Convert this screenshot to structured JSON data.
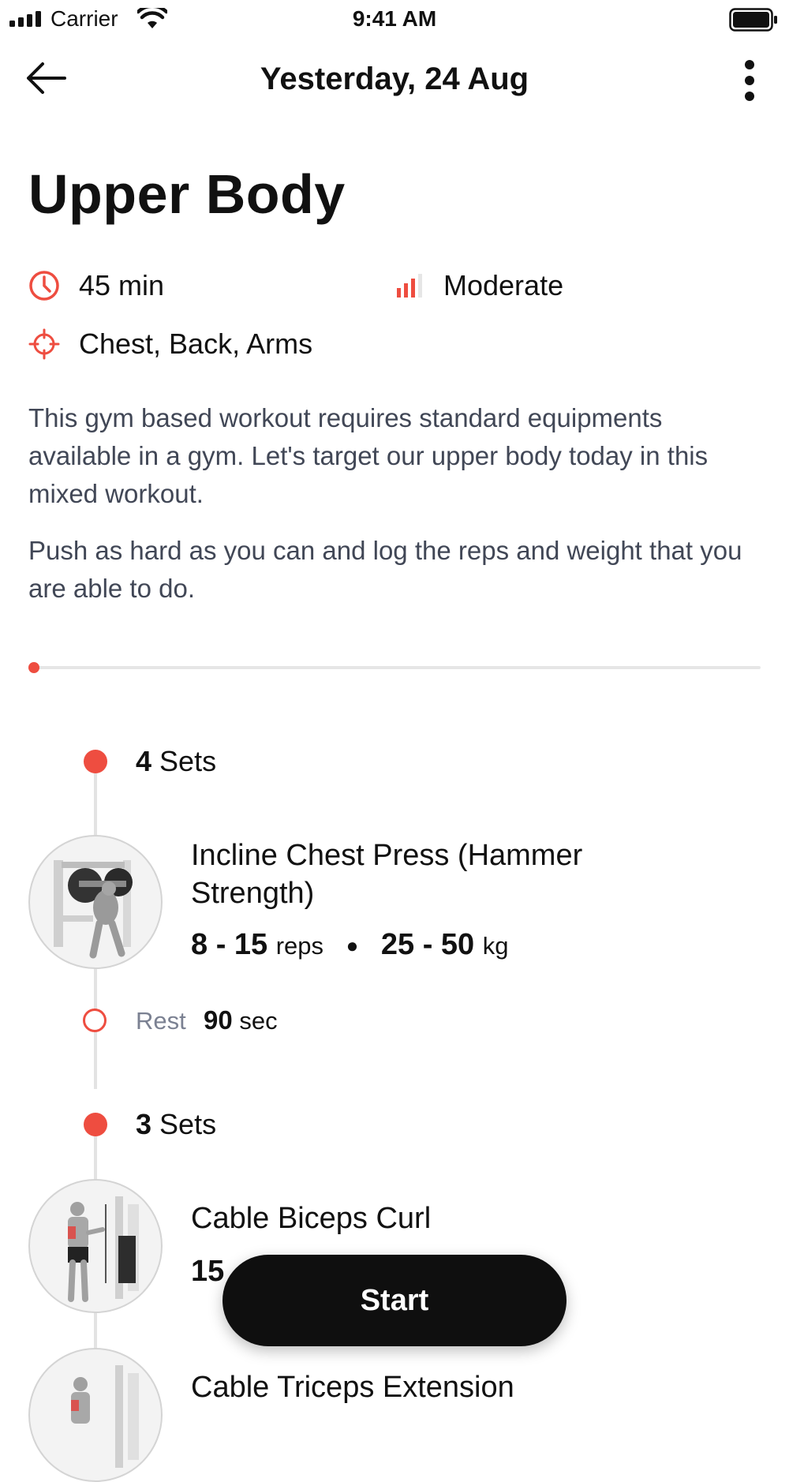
{
  "status_bar": {
    "carrier": "Carrier",
    "time": "9:41 AM"
  },
  "nav": {
    "title": "Yesterday, 24 Aug"
  },
  "workout": {
    "title": "Upper Body",
    "duration": "45 min",
    "level": "Moderate",
    "muscles": "Chest, Back, Arms",
    "description": [
      "This gym based workout requires standard equipments available in a gym. Let's target our upper body today in this mixed workout.",
      "Push as hard as you can and log the reps and weight that you are able to do."
    ]
  },
  "progress": {
    "fraction": 0.0
  },
  "exercises": [
    {
      "sets_count": "4",
      "sets_word": "Sets",
      "name": "Incline Chest Press (Hammer Strength)",
      "reps": "8 - 15",
      "reps_unit": "reps",
      "weight": "25 - 50",
      "weight_unit": "kg",
      "rest_label": "Rest",
      "rest_value": "90",
      "rest_unit": "sec"
    },
    {
      "sets_count": "3",
      "sets_word": "Sets",
      "name": "Cable Biceps Curl",
      "reps": "15"
    },
    {
      "name": "Cable Triceps Extension"
    }
  ],
  "actions": {
    "start_label": "Start"
  },
  "colors": {
    "accent": "#ee4d40",
    "button": "#0f0f0f",
    "body_text": "#414756",
    "muted": "#7b8192"
  },
  "icons": {
    "back": "arrow-left-icon",
    "more": "more-vertical-icon",
    "duration": "clock-icon",
    "level": "signal-bars-icon",
    "muscles": "target-icon"
  }
}
